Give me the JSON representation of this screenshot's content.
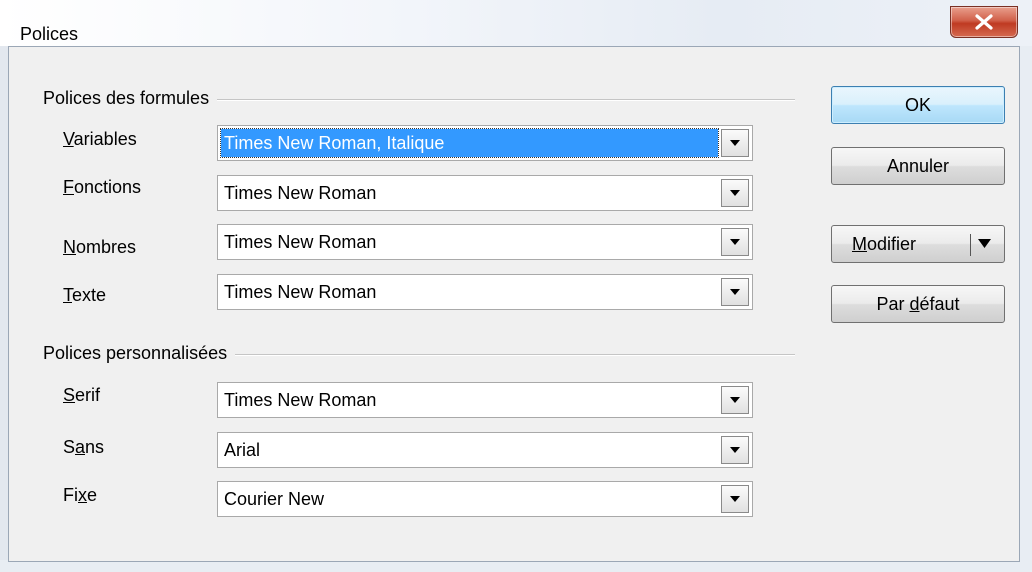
{
  "window": {
    "title": "Polices"
  },
  "formula_fonts": {
    "group_title": "Polices des formules",
    "fields": [
      {
        "label_prefix": "",
        "label_mnemonic": "V",
        "label_suffix": "ariables",
        "value": "Times New Roman, Italique",
        "selected": true
      },
      {
        "label_prefix": "",
        "label_mnemonic": "F",
        "label_suffix": "onctions",
        "value": "Times New Roman"
      },
      {
        "label_prefix": "",
        "label_mnemonic": "N",
        "label_suffix": "ombres",
        "value": "Times New Roman"
      },
      {
        "label_prefix": "",
        "label_mnemonic": "T",
        "label_suffix": "exte",
        "value": "Times New Roman"
      }
    ]
  },
  "custom_fonts": {
    "group_title": "Polices personnalisées",
    "fields": [
      {
        "label_prefix": "",
        "label_mnemonic": "S",
        "label_suffix": "erif",
        "value": "Times New Roman"
      },
      {
        "label_prefix": "S",
        "label_mnemonic": "a",
        "label_suffix": "ns",
        "value": "Arial"
      },
      {
        "label_prefix": "Fi",
        "label_mnemonic": "x",
        "label_suffix": "e",
        "value": "Courier New"
      }
    ]
  },
  "buttons": {
    "ok": "OK",
    "cancel": "Annuler",
    "modify_mnemonic": "M",
    "modify_rest": "odifier",
    "default_prefix": "Par ",
    "default_mnemonic": "d",
    "default_rest": "éfaut"
  },
  "icons": {
    "close": "close-icon",
    "dropdown": "chevron-down-icon"
  },
  "colors": {
    "selection": "#3399ff",
    "close_button": "#c9462f",
    "default_button": "#bee6fd"
  }
}
